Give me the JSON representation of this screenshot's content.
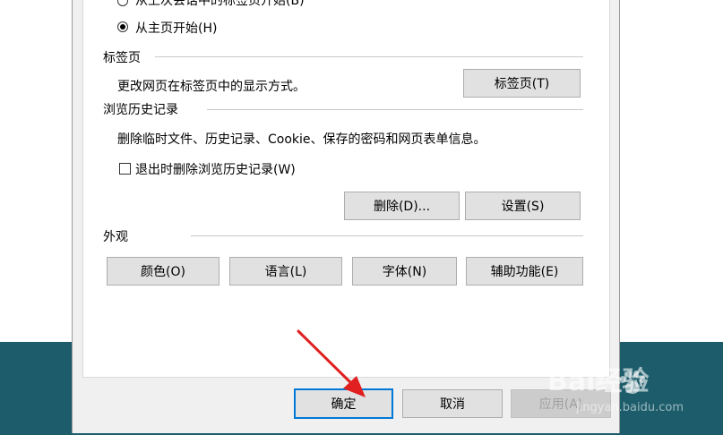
{
  "startup": {
    "option_last_session": "从上次会话中的标签页开始(B)",
    "option_home": "从主页开始(H)",
    "selected": "option_home"
  },
  "tabs": {
    "heading": "标签页",
    "description": "更改网页在标签页中的显示方式。",
    "button": "标签页(T)"
  },
  "history": {
    "heading": "浏览历史记录",
    "description": "删除临时文件、历史记录、Cookie、保存的密码和网页表单信息。",
    "checkbox_label": "退出时删除浏览历史记录(W)",
    "checkbox_checked": false,
    "delete_button": "删除(D)...",
    "settings_button": "设置(S)"
  },
  "appearance": {
    "heading": "外观",
    "buttons": [
      "颜色(O)",
      "语言(L)",
      "字体(N)",
      "辅助功能(E)"
    ]
  },
  "footer": {
    "ok": "确定",
    "cancel": "取消",
    "apply": "应用(A)"
  },
  "watermark": {
    "brand": "Bai经验",
    "url": "jingyan.baidu.com"
  },
  "colors": {
    "accent": "#0078d7",
    "arrow": "#e02020",
    "desktop": "#1d5d6b"
  }
}
